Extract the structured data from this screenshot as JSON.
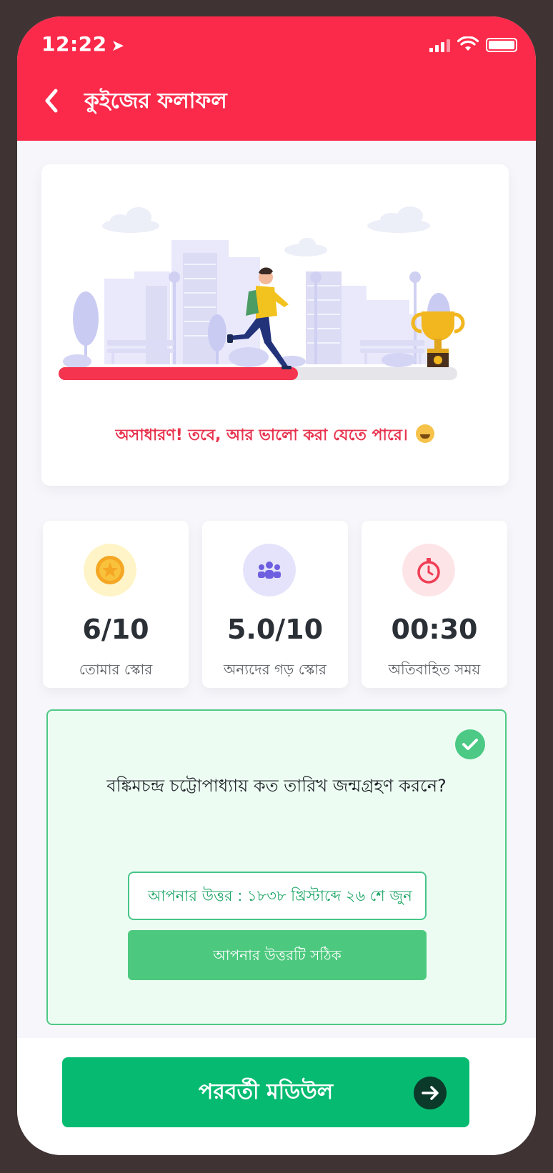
{
  "status_bar": {
    "time": "12:22",
    "location_icon": "location-arrow-icon"
  },
  "header": {
    "title": "কুইজের ফলাফল",
    "back_icon": "chevron-left-icon",
    "color": "#fb2a4a"
  },
  "hero": {
    "message": "অসাধারণ! তবে, আর ভালো করা যেতে পারে।",
    "emoji": "grinning-face-emoji",
    "progress": 0.6,
    "accent": "#e8334e"
  },
  "stats": [
    {
      "icon": "star-coin-icon",
      "value": "6/10",
      "label": "তোমার স্কোর"
    },
    {
      "icon": "group-users-icon",
      "value": "5.0/10",
      "label": "অন্যদের গড় স্কোর"
    },
    {
      "icon": "stopwatch-icon",
      "value": "00:30",
      "label": "অতিবাহিত সময়"
    }
  ],
  "question": {
    "text": "বঙ্কিমচন্দ্র চট্টোপাধ্যায় কত তারিখ জন্মগ্রহণ করনে?",
    "answer": "আপনার উত্তর : ১৮৩৮ খ্রিস্টাব্দে ২৬ শে জুন",
    "result": "আপনার উত্তরটি সঠিক",
    "success_color": "#4cc97e"
  },
  "footer": {
    "next_label": "পরবর্তী মডিউল",
    "primary_color": "#06bb71"
  }
}
